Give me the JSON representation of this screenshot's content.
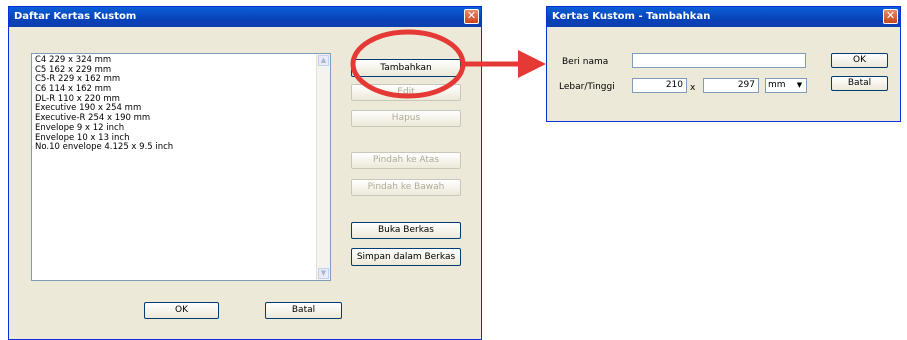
{
  "main_dialog": {
    "title": "Daftar Kertas Kustom",
    "paper_list": [
      "C4 229 x 324 mm",
      "C5 162 x 229 mm",
      "C5-R 229 x 162 mm",
      "C6 114 x 162 mm",
      "DL-R 110 x 220 mm",
      "Executive 190 x 254 mm",
      "Executive-R 254 x 190 mm",
      "Envelope 9 x 12 inch",
      "Envelope 10 x 13 inch",
      "No.10 envelope 4.125 x 9.5 inch"
    ],
    "buttons": {
      "add": "Tambahkan",
      "edit": "Edit",
      "delete": "Hapus",
      "move_up": "Pindah ke Atas",
      "move_down": "Pindah ke Bawah",
      "open_file": "Buka Berkas",
      "save_file": "Simpan dalam Berkas",
      "ok": "OK",
      "cancel": "Batal"
    }
  },
  "add_dialog": {
    "title": "Kertas Kustom - Tambahkan",
    "name_label": "Beri nama",
    "name_value": "",
    "size_label": "Lebar/Tinggi",
    "width_value": "210",
    "separator": "x",
    "height_value": "297",
    "unit_value": "mm",
    "ok": "OK",
    "cancel": "Batal"
  },
  "colors": {
    "titlebar": "#0842b8",
    "highlight_circle": "#e53935",
    "arrow": "#e53935",
    "dialog_bg": "#ece9d8"
  }
}
